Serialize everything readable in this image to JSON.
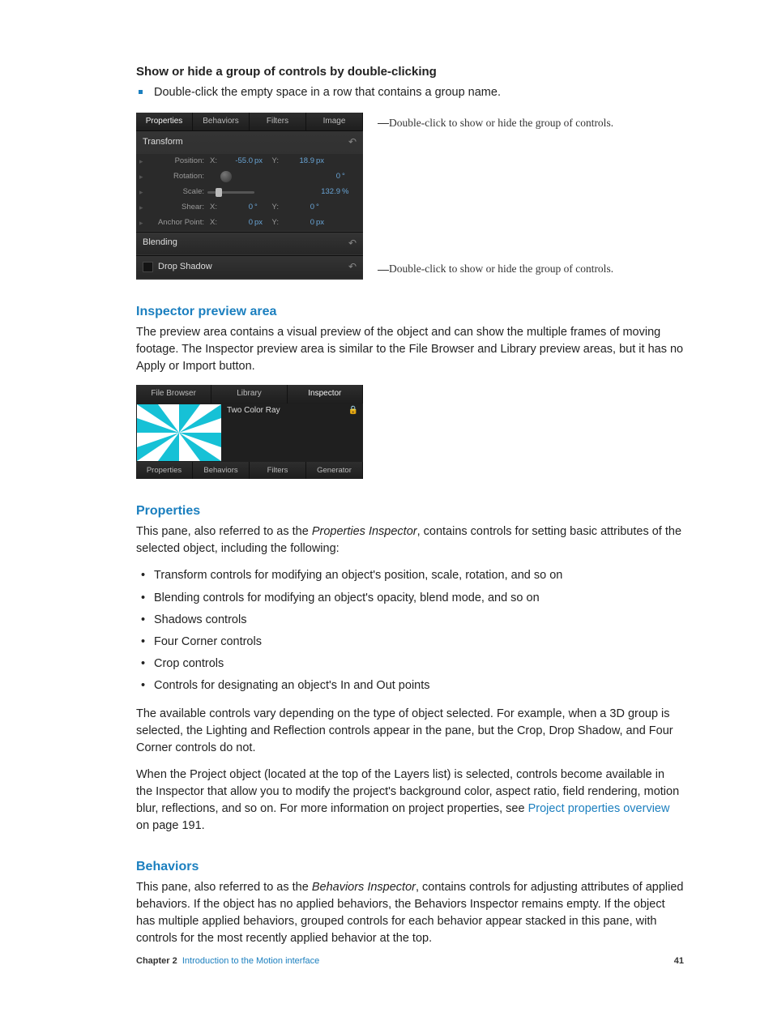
{
  "sections": {
    "s1_title": "Show or hide a group of controls by double-clicking",
    "s1_bullet": "Double-click the empty space in a row that contains a group name.",
    "preview_title": "Inspector preview area",
    "preview_body": "The preview area contains a visual preview of the object and can show the multiple frames of moving footage. The Inspector preview area is similar to the File Browser and Library preview areas, but it has no Apply or Import button.",
    "props_title": "Properties",
    "props_intro_a": "This pane, also referred to as the ",
    "props_intro_em": "Properties Inspector",
    "props_intro_b": ", contains controls for setting basic attributes of the selected object, including the following:",
    "props_items": [
      "Transform controls for modifying an object's position, scale, rotation, and so on",
      "Blending controls for modifying an object's opacity, blend mode, and so on",
      "Shadows controls",
      "Four Corner controls",
      "Crop controls",
      "Controls for designating an object's In and Out points"
    ],
    "props_p2": "The available controls vary depending on the type of object selected. For example, when a 3D group is selected, the Lighting and Reflection controls appear in the pane, but the Crop, Drop Shadow, and Four Corner controls do not.",
    "props_p3a": "When the Project object (located at the top of the Layers list) is selected, controls become available in the Inspector that allow you to modify the project's background color, aspect ratio, field rendering, motion blur, reflections, and so on. For more information on project properties, see ",
    "props_link": "Project properties overview",
    "props_p3b": " on page 191.",
    "beh_title": "Behaviors",
    "beh_intro_a": "This pane, also referred to as the ",
    "beh_intro_em": "Behaviors Inspector",
    "beh_intro_b": ", contains controls for adjusting attributes of applied behaviors. If the object has no applied behaviors, the Behaviors Inspector remains empty. If the object has multiple applied behaviors, grouped controls for each behavior appear stacked in this pane, with controls for the most recently applied behavior at the top."
  },
  "fig1": {
    "tabs": {
      "properties": "Properties",
      "behaviors": "Behaviors",
      "filters": "Filters",
      "image": "Image"
    },
    "groups": {
      "transform": "Transform",
      "blending": "Blending",
      "dropshadow": "Drop Shadow"
    },
    "rows": {
      "position": {
        "lbl": "Position:",
        "x": "X:",
        "xv": "-55.0",
        "xu": "px",
        "y": "Y:",
        "yv": "18.9",
        "yu": "px"
      },
      "rotation": {
        "lbl": "Rotation:",
        "v": "0",
        "u": "°"
      },
      "scale": {
        "lbl": "Scale:",
        "v": "132.9",
        "u": "%"
      },
      "shear": {
        "lbl": "Shear:",
        "x": "X:",
        "xv": "0",
        "xu": "°",
        "y": "Y:",
        "yv": "0",
        "yu": "°"
      },
      "anchor": {
        "lbl": "Anchor Point:",
        "x": "X:",
        "xv": "0",
        "xu": "px",
        "y": "Y:",
        "yv": "0",
        "yu": "px"
      }
    },
    "annot1": "Double-click to show or hide the group of controls.",
    "annot2": "Double-click to show or hide the group of controls.",
    "reset": "↶"
  },
  "fig2": {
    "top": {
      "fb": "File Browser",
      "lib": "Library",
      "insp": "Inspector"
    },
    "title": "Two Color Ray",
    "bottom": {
      "props": "Properties",
      "beh": "Behaviors",
      "fil": "Filters",
      "gen": "Generator"
    }
  },
  "footer": {
    "ch": "Chapter 2",
    "title": "Introduction to the Motion interface",
    "page": "41"
  }
}
